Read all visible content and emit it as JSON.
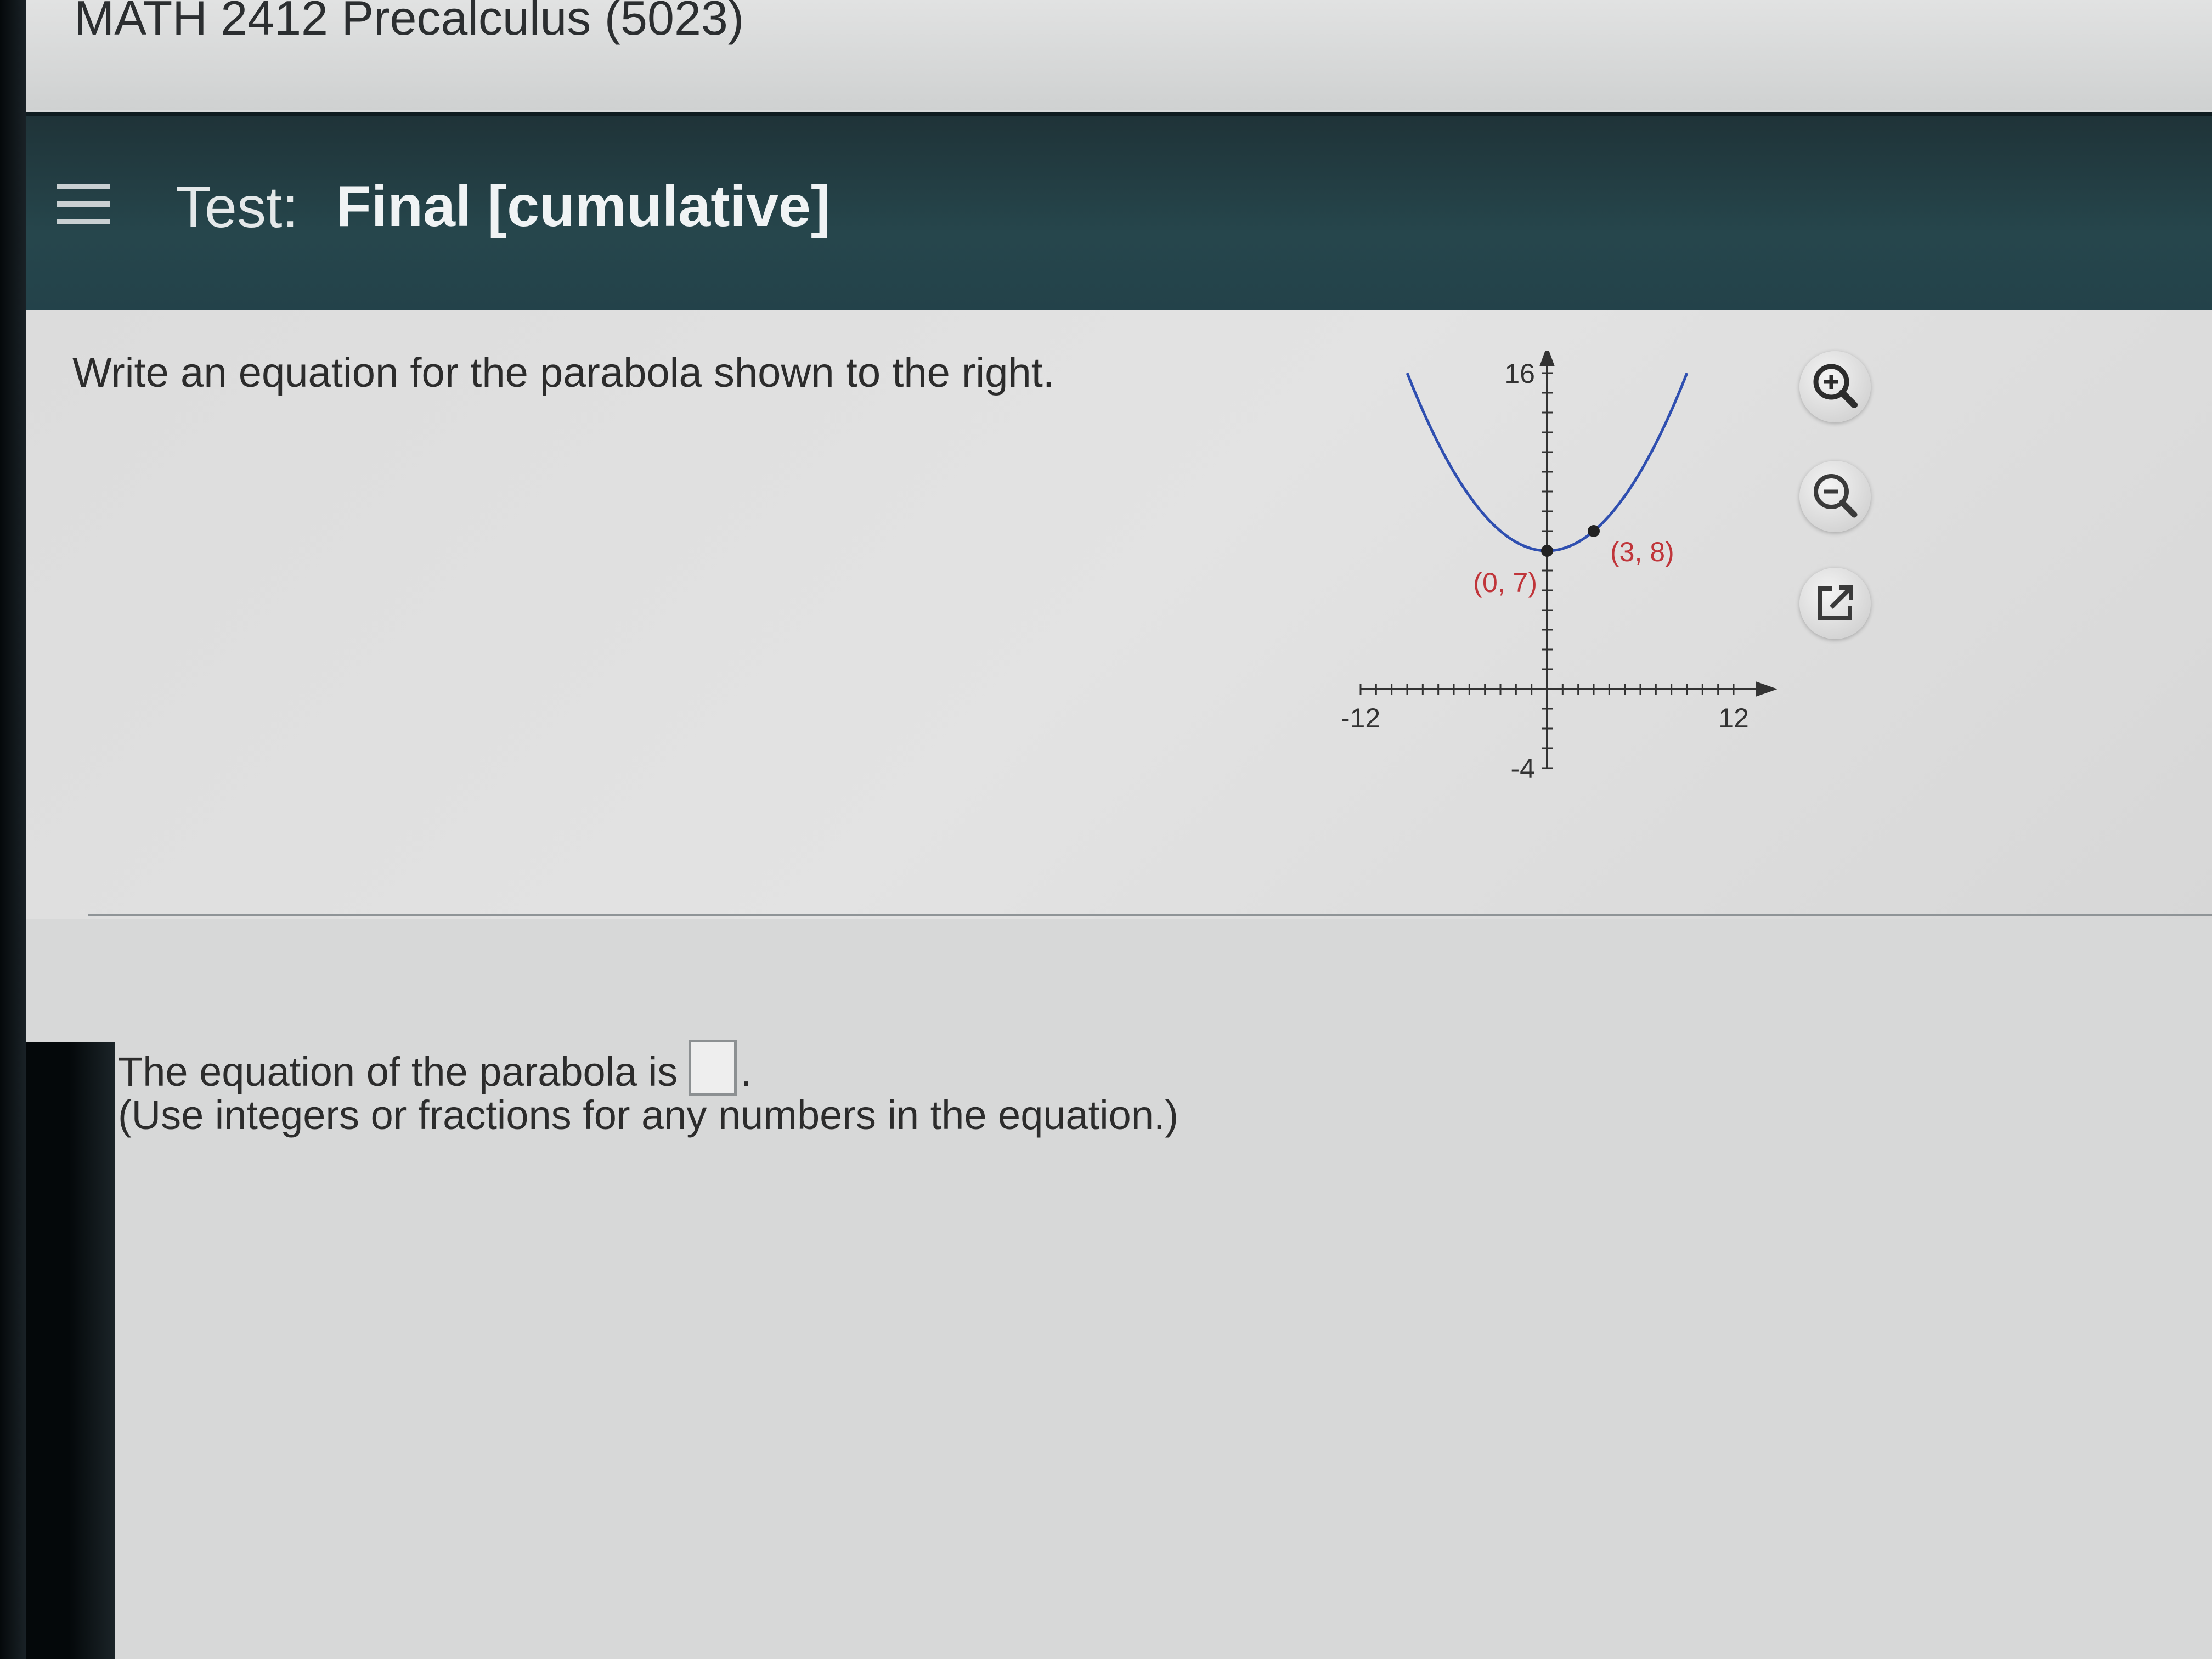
{
  "course": {
    "title": "MATH 2412 Precalculus (5023)"
  },
  "header": {
    "menu_icon": "hamburger-menu-icon",
    "test_label": "Test:",
    "test_name": "Final [cumulative]"
  },
  "question": {
    "prompt": "Write an equation for the parabola shown to the right."
  },
  "tools": {
    "zoom_in_icon": "zoom-in-icon",
    "zoom_out_icon": "zoom-out-icon",
    "popout_icon": "popout-icon"
  },
  "answer": {
    "prefix": "The equation of the parabola is",
    "value": "",
    "suffix": ".",
    "instruction": "(Use integers or fractions for any numbers in the equation.)"
  },
  "chart_data": {
    "type": "line",
    "title": "",
    "xlabel": "",
    "ylabel": "",
    "xlim": [
      -12,
      12
    ],
    "ylim": [
      -4,
      16
    ],
    "x_tick_labels": [
      "-12",
      "12"
    ],
    "y_tick_labels": [
      "16",
      "-4"
    ],
    "grid": false,
    "curve": {
      "equation_form": "parabola",
      "x_range": [
        -9,
        9
      ]
    },
    "points": [
      {
        "x": 0,
        "y": 7,
        "label": "(0, 7)"
      },
      {
        "x": 3,
        "y": 8,
        "label": "(3, 8)"
      }
    ],
    "colors": {
      "curve": "#2f4fb0",
      "labels": "#c0353a",
      "axes": "#333333"
    }
  }
}
